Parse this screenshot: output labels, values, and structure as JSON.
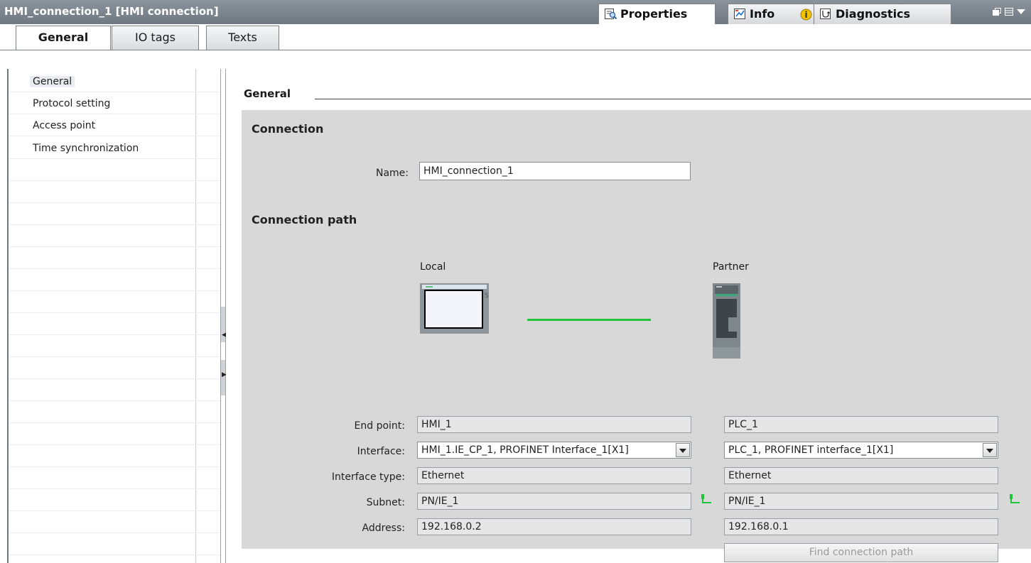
{
  "window": {
    "title": "HMI_connection_1 [HMI connection]",
    "tabs": [
      {
        "label": "Properties",
        "icon": "properties-icon"
      },
      {
        "label": "Info",
        "icon": "info-icon"
      },
      {
        "label": "Diagnostics",
        "icon": "diagnostics-icon"
      }
    ]
  },
  "tabs": [
    "General",
    "IO tags",
    "Texts"
  ],
  "tree": {
    "items": [
      "General",
      "Protocol setting",
      "Access point",
      "Time synchronization"
    ]
  },
  "section": {
    "title": "General"
  },
  "connection": {
    "heading": "Connection",
    "name_label": "Name:",
    "name_value": "HMI_connection_1"
  },
  "path": {
    "heading": "Connection path",
    "local_label": "Local",
    "partner_label": "Partner",
    "labels": {
      "end_point": "End point:",
      "interface": "Interface:",
      "interface_type": "Interface type:",
      "subnet": "Subnet:",
      "address": "Address:"
    },
    "local": {
      "end_point": "HMI_1",
      "interface": "HMI_1.IE_CP_1, PROFINET Interface_1[X1]",
      "interface_type": "Ethernet",
      "subnet": "PN/IE_1",
      "address": "192.168.0.2"
    },
    "partner": {
      "end_point": "PLC_1",
      "interface": "PLC_1, PROFINET interface_1[X1]",
      "interface_type": "Ethernet",
      "subnet": "PN/IE_1",
      "address": "192.168.0.1"
    },
    "find_button": "Find connection path"
  },
  "colors": {
    "accent": "#8b949c",
    "link_line": "#22c43a"
  }
}
